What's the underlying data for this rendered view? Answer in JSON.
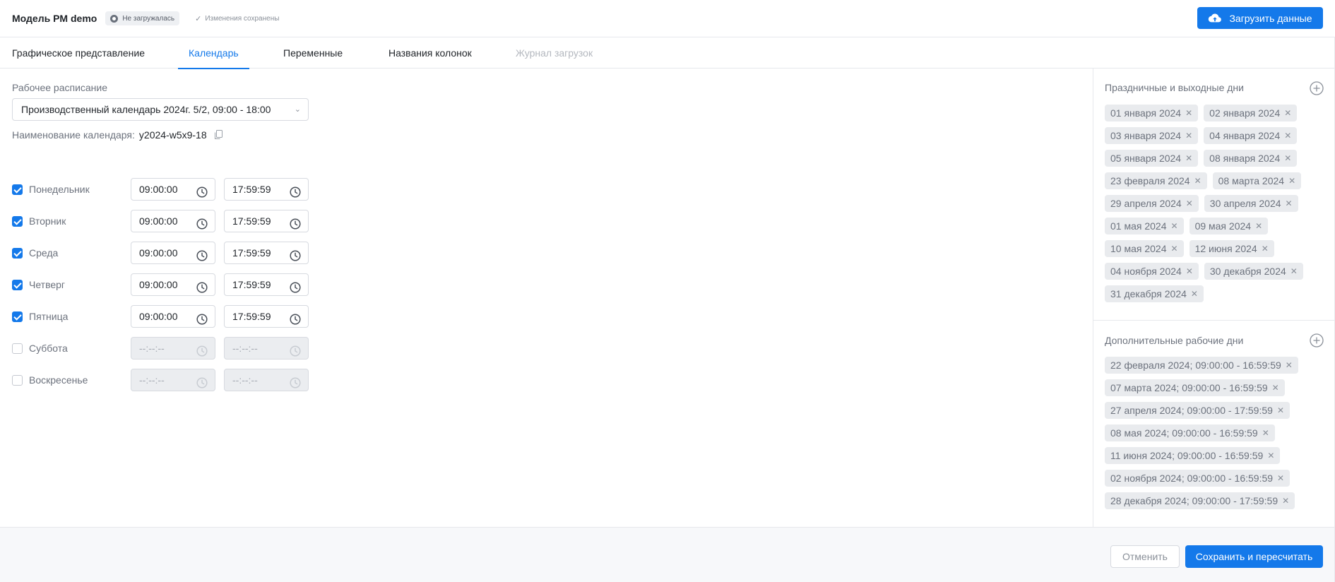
{
  "header": {
    "title": "Модель PM demo",
    "status_badge": "Не загружалась",
    "saved_text": "Изменения сохранены",
    "upload_button": "Загрузить данные"
  },
  "tabs": [
    {
      "label": "Графическое представление",
      "state": "normal"
    },
    {
      "label": "Календарь",
      "state": "active"
    },
    {
      "label": "Переменные",
      "state": "normal"
    },
    {
      "label": "Названия колонок",
      "state": "normal"
    },
    {
      "label": "Журнал загрузок",
      "state": "disabled"
    }
  ],
  "schedule": {
    "label": "Рабочее расписание",
    "selected": "Производственный календарь 2024г. 5/2, 09:00 - 18:00",
    "calendar_name_label": "Наименование календаря:",
    "calendar_name_value": "y2024-w5x9-18"
  },
  "days": [
    {
      "name": "Понедельник",
      "checked": true,
      "start": "09:00:00",
      "end": "17:59:59"
    },
    {
      "name": "Вторник",
      "checked": true,
      "start": "09:00:00",
      "end": "17:59:59"
    },
    {
      "name": "Среда",
      "checked": true,
      "start": "09:00:00",
      "end": "17:59:59"
    },
    {
      "name": "Четверг",
      "checked": true,
      "start": "09:00:00",
      "end": "17:59:59"
    },
    {
      "name": "Пятница",
      "checked": true,
      "start": "09:00:00",
      "end": "17:59:59"
    },
    {
      "name": "Суббота",
      "checked": false,
      "start": "--:--:--",
      "end": "--:--:--"
    },
    {
      "name": "Воскресенье",
      "checked": false,
      "start": "--:--:--",
      "end": "--:--:--"
    }
  ],
  "holidays": {
    "title": "Праздничные и выходные дни",
    "items": [
      "01 января 2024",
      "02 января 2024",
      "03 января 2024",
      "04 января 2024",
      "05 января 2024",
      "08 января 2024",
      "23 февраля 2024",
      "08 марта 2024",
      "29 апреля 2024",
      "30 апреля 2024",
      "01 мая 2024",
      "09 мая 2024",
      "10 мая 2024",
      "12 июня 2024",
      "04 ноября 2024",
      "30 декабря 2024",
      "31 декабря 2024"
    ]
  },
  "extra_workdays": {
    "title": "Дополнительные рабочие дни",
    "items": [
      "22 февраля 2024; 09:00:00 - 16:59:59",
      "07 марта 2024; 09:00:00 - 16:59:59",
      "27 апреля 2024; 09:00:00 - 17:59:59",
      "08 мая 2024; 09:00:00 - 16:59:59",
      "11 июня 2024; 09:00:00 - 16:59:59",
      "02 ноября 2024; 09:00:00 - 16:59:59",
      "28 декабря 2024; 09:00:00 - 17:59:59"
    ]
  },
  "footer": {
    "cancel_label": "Отменить",
    "save_label": "Сохранить и пересчитать"
  },
  "colors": {
    "accent": "#1479ea",
    "chip_bg": "#e9ebee",
    "muted_text": "#6c727d"
  }
}
